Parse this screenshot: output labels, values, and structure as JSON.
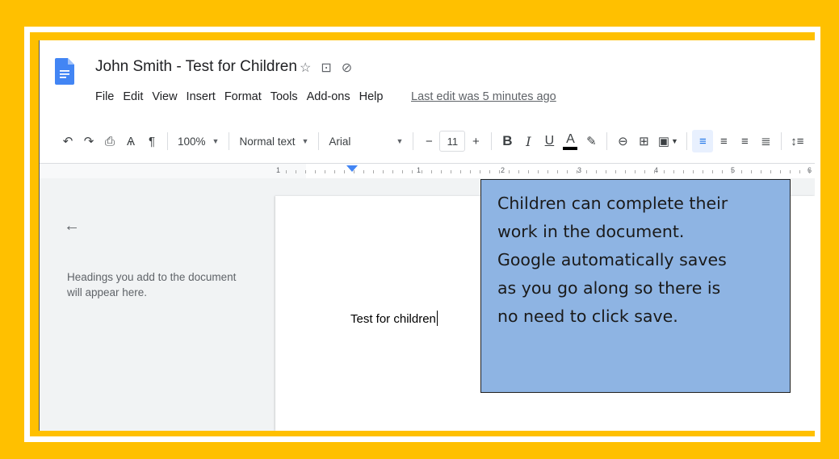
{
  "app": {
    "doc_title": "John Smith - Test for Children",
    "title_icons": [
      "star-icon",
      "move-to-folder-icon",
      "cloud-status-icon"
    ],
    "menu": [
      "File",
      "Edit",
      "View",
      "Insert",
      "Format",
      "Tools",
      "Add-ons",
      "Help"
    ],
    "last_edit": "Last edit was 5 minutes ago"
  },
  "toolbar": {
    "zoom": "100%",
    "style": "Normal text",
    "font": "Arial",
    "font_size": "11",
    "minus": "−",
    "plus": "+",
    "bold": "B",
    "italic": "I",
    "underline": "U",
    "text_color": "A"
  },
  "ruler": {
    "numbers": [
      "1",
      "1",
      "2",
      "3",
      "4",
      "5",
      "6"
    ]
  },
  "outline": {
    "hint": "Headings you add to the document will appear here."
  },
  "document": {
    "body_text": "Test for children"
  },
  "callout": {
    "lines": [
      "Children can complete their",
      "work in the document.",
      "Google automatically saves",
      "as you go along so there is",
      "no need to click save."
    ],
    "background": "#8eb4e3"
  },
  "colors": {
    "frame": "#ffc000",
    "accent": "#1a73e8"
  }
}
